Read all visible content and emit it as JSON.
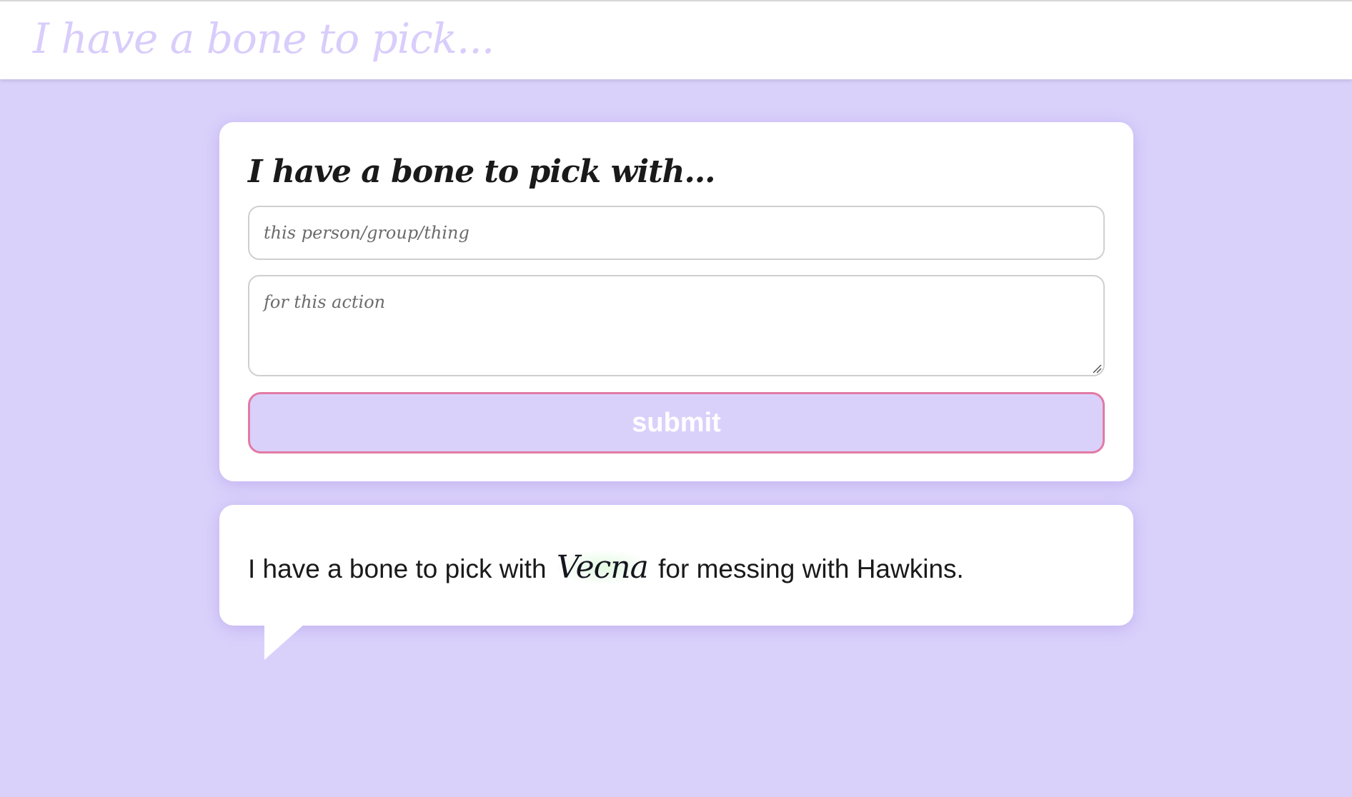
{
  "header": {
    "title": "I have a bone to pick..."
  },
  "form": {
    "heading": "I have a bone to pick with...",
    "person_placeholder": "this person/group/thing",
    "action_placeholder": "for this action",
    "submit_label": "submit"
  },
  "result": {
    "prefix": "I have a bone to pick with",
    "name": "Vecna",
    "suffix": "for messing with Hawkins."
  },
  "colors": {
    "background": "#dad1fb",
    "header_title": "#d9cdfb",
    "submit_border": "#e27aa4",
    "card": "#ffffff"
  }
}
